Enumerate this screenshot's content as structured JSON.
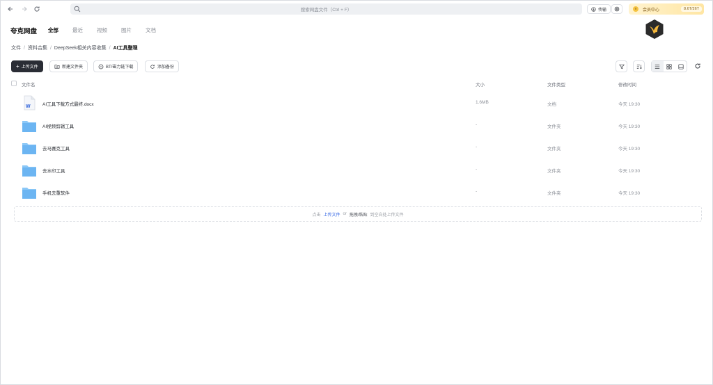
{
  "topbar": {
    "search_placeholder": "搜索网盘文件（Ctrl + F）",
    "transfer_label": "传输",
    "vip_label": "会员中心",
    "vip_icon": "v",
    "storage": "8.6T/26T"
  },
  "header": {
    "brand": "夸克网盘",
    "tabs": [
      {
        "label": "全部",
        "active": true
      },
      {
        "label": "最近",
        "active": false
      },
      {
        "label": "视频",
        "active": false
      },
      {
        "label": "图片",
        "active": false
      },
      {
        "label": "文档",
        "active": false
      }
    ]
  },
  "breadcrumb": [
    "文件",
    "资料合集",
    "DeepSeek相关内容收集",
    "AI工具整理"
  ],
  "toolbar": {
    "upload": "上传文件",
    "new_folder": "新建文件夹",
    "bt_download": "BT/磁力链下载",
    "add_backup": "添加备份"
  },
  "table": {
    "headers": {
      "name": "文件名",
      "size": "大小",
      "type": "文件类型",
      "time": "修改时间"
    },
    "rows": [
      {
        "name": "AI工具下载方式最终.docx",
        "size": "1.6MB",
        "type": "文档",
        "time": "今天 19:30",
        "icon": "word-doc-icon"
      },
      {
        "name": "AI视频剪辑工具",
        "size": "-",
        "type": "文件夹",
        "time": "今天 19:30",
        "icon": "folder-icon"
      },
      {
        "name": "去马赛克工具",
        "size": "-",
        "type": "文件夹",
        "time": "今天 19:30",
        "icon": "folder-icon"
      },
      {
        "name": "去水印工具",
        "size": "-",
        "type": "文件夹",
        "time": "今天 19:30",
        "icon": "folder-icon"
      },
      {
        "name": "手机去重软件",
        "size": "-",
        "type": "文件夹",
        "time": "今天 19:30",
        "icon": "folder-icon"
      }
    ]
  },
  "dropzone": {
    "prefix": "点击",
    "upload_link": "上传文件",
    "or": "or",
    "drag": "拖拽/粘贴",
    "suffix": "到空白处上传文件"
  },
  "colors": {
    "accent": "#3b6ce6",
    "primary_button": "#2a2d35",
    "folder": "#6cb5f2"
  }
}
